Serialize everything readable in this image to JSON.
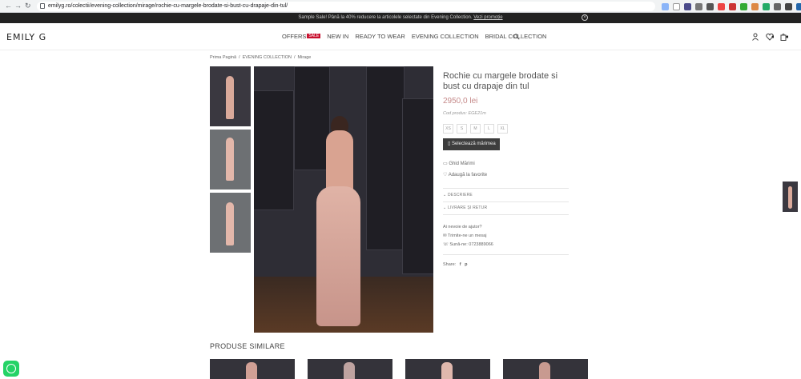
{
  "browser": {
    "url": "emilyg.ro/colectii/evening-collection/mirage/rochie-cu-margele-brodate-si-bust-cu-drapaje-din-tul/",
    "back": "←",
    "forward": "→",
    "reload": "↻"
  },
  "promo": {
    "text": "Sample Sale! Până la 40% reducere la articolele selectate din Evening Collection.",
    "link": "Vezi promoție",
    "close": "×"
  },
  "header": {
    "logo": "EMILY G",
    "nav": [
      "OFFERS",
      "NEW IN",
      "READY TO WEAR",
      "EVENING COLLECTION",
      "BRIDAL COLLECTION"
    ],
    "offers_tag": "SALE"
  },
  "breadcrumb": [
    "Prima Pagină",
    "EVENING COLLECTION",
    "Mirage"
  ],
  "product": {
    "title": "Rochie cu margele brodate si bust cu drapaje din tul",
    "price": "2950,0 lei",
    "sku": "Cod produs: EGE21m",
    "sizes": [
      "XS",
      "S",
      "M",
      "L",
      "XL"
    ],
    "select_size": "Selectează mărimea",
    "size_guide": "Ghid Mărimi",
    "favorite": "Adaugă la favorite",
    "description": "DESCRIERE",
    "delivery": "LIVRARE ȘI RETUR",
    "help_title": "Ai nevoie de ajutor?",
    "message": "Trimite-ne un mesaj",
    "phone": "Sună-ne: 0723889066",
    "share": "Share:"
  },
  "similar": {
    "title": "PRODUSE SIMILARE"
  },
  "colors": {
    "accent_price": "#c58a8a",
    "promo_bg": "#222222",
    "button_bg": "#3d3d3d",
    "offers_tag": "#c8102e",
    "whatsapp": "#25d366"
  }
}
